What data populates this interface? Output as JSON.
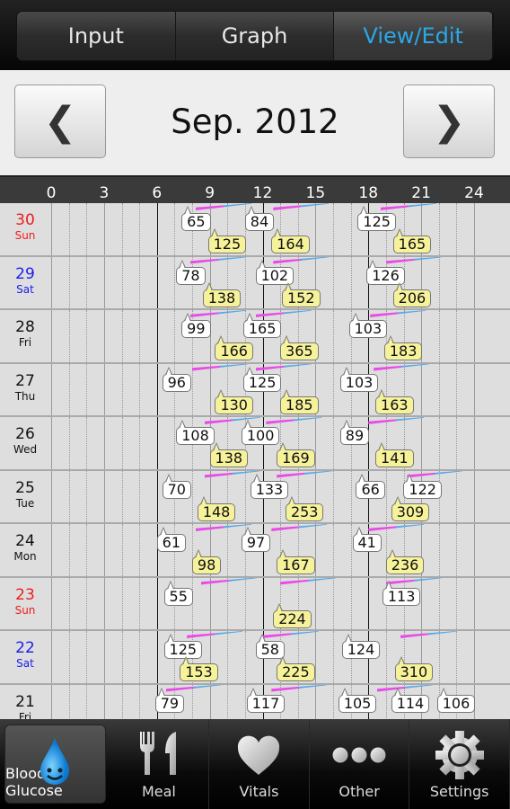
{
  "tabs": [
    {
      "label": "Input",
      "active": false
    },
    {
      "label": "Graph",
      "active": false
    },
    {
      "label": "View/Edit",
      "active": true
    }
  ],
  "month_nav": {
    "prev_icon": "chevron-left-icon",
    "prev": "❮",
    "title": "Sep. 2012",
    "next_icon": "chevron-right-icon",
    "next": "❯"
  },
  "axis": {
    "ticks": [
      "0",
      "3",
      "6",
      "9",
      "12",
      "15",
      "18",
      "21",
      "24"
    ],
    "unit": "hour"
  },
  "colors": {
    "accent": "#2aa8e8",
    "sunday": "#ee1c1c",
    "saturday": "#1c1cee",
    "pre_meal_bubble": "#ffffff",
    "post_meal_bubble": "#f6f29a",
    "meal_marker_a": "#e84ce8",
    "meal_marker_b": "#58a8e8"
  },
  "days": [
    {
      "day": "30",
      "weekday": "Sun",
      "meals": [
        8.2,
        12.6,
        18.7
      ],
      "readings": [
        {
          "h": 7.6,
          "v": "65",
          "t": "pre"
        },
        {
          "h": 9.1,
          "v": "125",
          "t": "post"
        },
        {
          "h": 11.2,
          "v": "84",
          "t": "pre"
        },
        {
          "h": 12.7,
          "v": "164",
          "t": "post"
        },
        {
          "h": 17.6,
          "v": "125",
          "t": "pre"
        },
        {
          "h": 19.6,
          "v": "165",
          "t": "post"
        }
      ]
    },
    {
      "day": "29",
      "weekday": "Sat",
      "meals": [
        7.9,
        12.6,
        19.0
      ],
      "readings": [
        {
          "h": 7.3,
          "v": "78",
          "t": "pre"
        },
        {
          "h": 8.8,
          "v": "138",
          "t": "post"
        },
        {
          "h": 11.8,
          "v": "102",
          "t": "pre"
        },
        {
          "h": 13.3,
          "v": "152",
          "t": "post"
        },
        {
          "h": 18.1,
          "v": "126",
          "t": "pre"
        },
        {
          "h": 19.6,
          "v": "206",
          "t": "post"
        }
      ]
    },
    {
      "day": "28",
      "weekday": "Fri",
      "meals": [
        7.9,
        11.6,
        18.1
      ],
      "readings": [
        {
          "h": 7.6,
          "v": "99",
          "t": "pre"
        },
        {
          "h": 9.5,
          "v": "166",
          "t": "post"
        },
        {
          "h": 11.1,
          "v": "165",
          "t": "pre"
        },
        {
          "h": 13.2,
          "v": "365",
          "t": "post"
        },
        {
          "h": 17.1,
          "v": "103",
          "t": "pre"
        },
        {
          "h": 19.1,
          "v": "183",
          "t": "post"
        }
      ]
    },
    {
      "day": "27",
      "weekday": "Thu",
      "meals": [
        8.0,
        11.6,
        18.3
      ],
      "readings": [
        {
          "h": 6.5,
          "v": "96",
          "t": "pre"
        },
        {
          "h": 9.5,
          "v": "130",
          "t": "post"
        },
        {
          "h": 11.1,
          "v": "125",
          "t": "pre"
        },
        {
          "h": 13.2,
          "v": "185",
          "t": "post"
        },
        {
          "h": 16.6,
          "v": "103",
          "t": "pre"
        },
        {
          "h": 18.6,
          "v": "163",
          "t": "post"
        }
      ]
    },
    {
      "day": "26",
      "weekday": "Wed",
      "meals": [
        8.7,
        12.2,
        18.0
      ],
      "readings": [
        {
          "h": 7.3,
          "v": "108",
          "t": "pre"
        },
        {
          "h": 9.2,
          "v": "138",
          "t": "post"
        },
        {
          "h": 11.0,
          "v": "100",
          "t": "pre"
        },
        {
          "h": 13.0,
          "v": "169",
          "t": "post"
        },
        {
          "h": 16.6,
          "v": "89",
          "t": "pre"
        },
        {
          "h": 18.6,
          "v": "141",
          "t": "post"
        }
      ]
    },
    {
      "day": "25",
      "weekday": "Tue",
      "meals": [
        8.7,
        12.8,
        20.2
      ],
      "readings": [
        {
          "h": 6.5,
          "v": "70",
          "t": "pre"
        },
        {
          "h": 8.5,
          "v": "148",
          "t": "post"
        },
        {
          "h": 11.5,
          "v": "133",
          "t": "pre"
        },
        {
          "h": 13.5,
          "v": "253",
          "t": "post"
        },
        {
          "h": 17.5,
          "v": "66",
          "t": "pre"
        },
        {
          "h": 20.2,
          "v": "122",
          "t": "pre"
        },
        {
          "h": 19.5,
          "v": "309",
          "t": "post"
        }
      ]
    },
    {
      "day": "24",
      "weekday": "Mon",
      "meals": [
        8.2,
        12.5,
        18.0
      ],
      "readings": [
        {
          "h": 6.2,
          "v": "61",
          "t": "pre"
        },
        {
          "h": 8.2,
          "v": "98",
          "t": "post"
        },
        {
          "h": 11.0,
          "v": "97",
          "t": "pre"
        },
        {
          "h": 13.0,
          "v": "167",
          "t": "post"
        },
        {
          "h": 17.3,
          "v": "41",
          "t": "pre"
        },
        {
          "h": 19.2,
          "v": "236",
          "t": "post"
        }
      ]
    },
    {
      "day": "23",
      "weekday": "Sun",
      "meals": [
        8.5,
        13.0,
        19.0
      ],
      "readings": [
        {
          "h": 6.6,
          "v": "55",
          "t": "pre"
        },
        {
          "h": 12.8,
          "v": "224",
          "t": "post"
        },
        {
          "h": 19.0,
          "v": "113",
          "t": "pre"
        }
      ]
    },
    {
      "day": "22",
      "weekday": "Sat",
      "meals": [
        7.7,
        12.0,
        19.8
      ],
      "readings": [
        {
          "h": 6.6,
          "v": "125",
          "t": "pre"
        },
        {
          "h": 7.5,
          "v": "153",
          "t": "post"
        },
        {
          "h": 11.8,
          "v": "58",
          "t": "pre"
        },
        {
          "h": 13.0,
          "v": "225",
          "t": "post"
        },
        {
          "h": 16.7,
          "v": "124",
          "t": "pre"
        },
        {
          "h": 19.7,
          "v": "310",
          "t": "post"
        }
      ]
    },
    {
      "day": "21",
      "weekday": "Fri",
      "meals": [
        6.5,
        12.5,
        18.5
      ],
      "readings": [
        {
          "h": 6.1,
          "v": "79",
          "t": "pre"
        },
        {
          "h": 11.3,
          "v": "117",
          "t": "pre"
        },
        {
          "h": 16.5,
          "v": "105",
          "t": "pre"
        },
        {
          "h": 19.5,
          "v": "114",
          "t": "pre"
        },
        {
          "h": 22.1,
          "v": "106",
          "t": "pre"
        }
      ]
    }
  ],
  "bottom_nav": [
    {
      "label": "Blood Glucose",
      "icon": "blood-drop-icon",
      "active": true
    },
    {
      "label": "Meal",
      "icon": "fork-knife-icon",
      "active": false
    },
    {
      "label": "Vitals",
      "icon": "heart-icon",
      "active": false
    },
    {
      "label": "Other",
      "icon": "more-dots-icon",
      "active": false
    },
    {
      "label": "Settings",
      "icon": "gear-icon",
      "active": false
    }
  ]
}
